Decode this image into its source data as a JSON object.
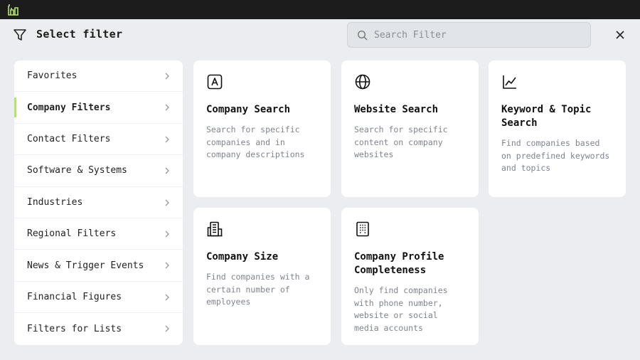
{
  "header": {
    "title": "Select filter",
    "search_placeholder": "Search Filter"
  },
  "sidebar": {
    "items": [
      {
        "label": "Favorites"
      },
      {
        "label": "Company Filters"
      },
      {
        "label": "Contact Filters"
      },
      {
        "label": "Software & Systems"
      },
      {
        "label": "Industries"
      },
      {
        "label": "Regional Filters"
      },
      {
        "label": "News & Trigger Events"
      },
      {
        "label": "Financial Figures"
      },
      {
        "label": "Filters for Lists"
      }
    ],
    "active_index": 1
  },
  "cards": [
    {
      "title": "Company Search",
      "description": "Search for specific companies and in company descriptions",
      "icon": "text-a-icon"
    },
    {
      "title": "Website Search",
      "description": "Search for specific content on company websites",
      "icon": "globe-icon"
    },
    {
      "title": "Keyword & Topic Search",
      "description": "Find companies based on predefined keywords and topics",
      "icon": "line-chart-icon"
    },
    {
      "title": "Company Size",
      "description": "Find companies with a certain number of employees",
      "icon": "buildings-icon"
    },
    {
      "title": "Company Profile Completeness",
      "description": "Only find companies with phone number, website or social media accounts",
      "icon": "building-icon"
    }
  ],
  "colors": {
    "background": "#ebedf1",
    "topbar": "#1c1c1c",
    "accent": "#b7e36a"
  }
}
